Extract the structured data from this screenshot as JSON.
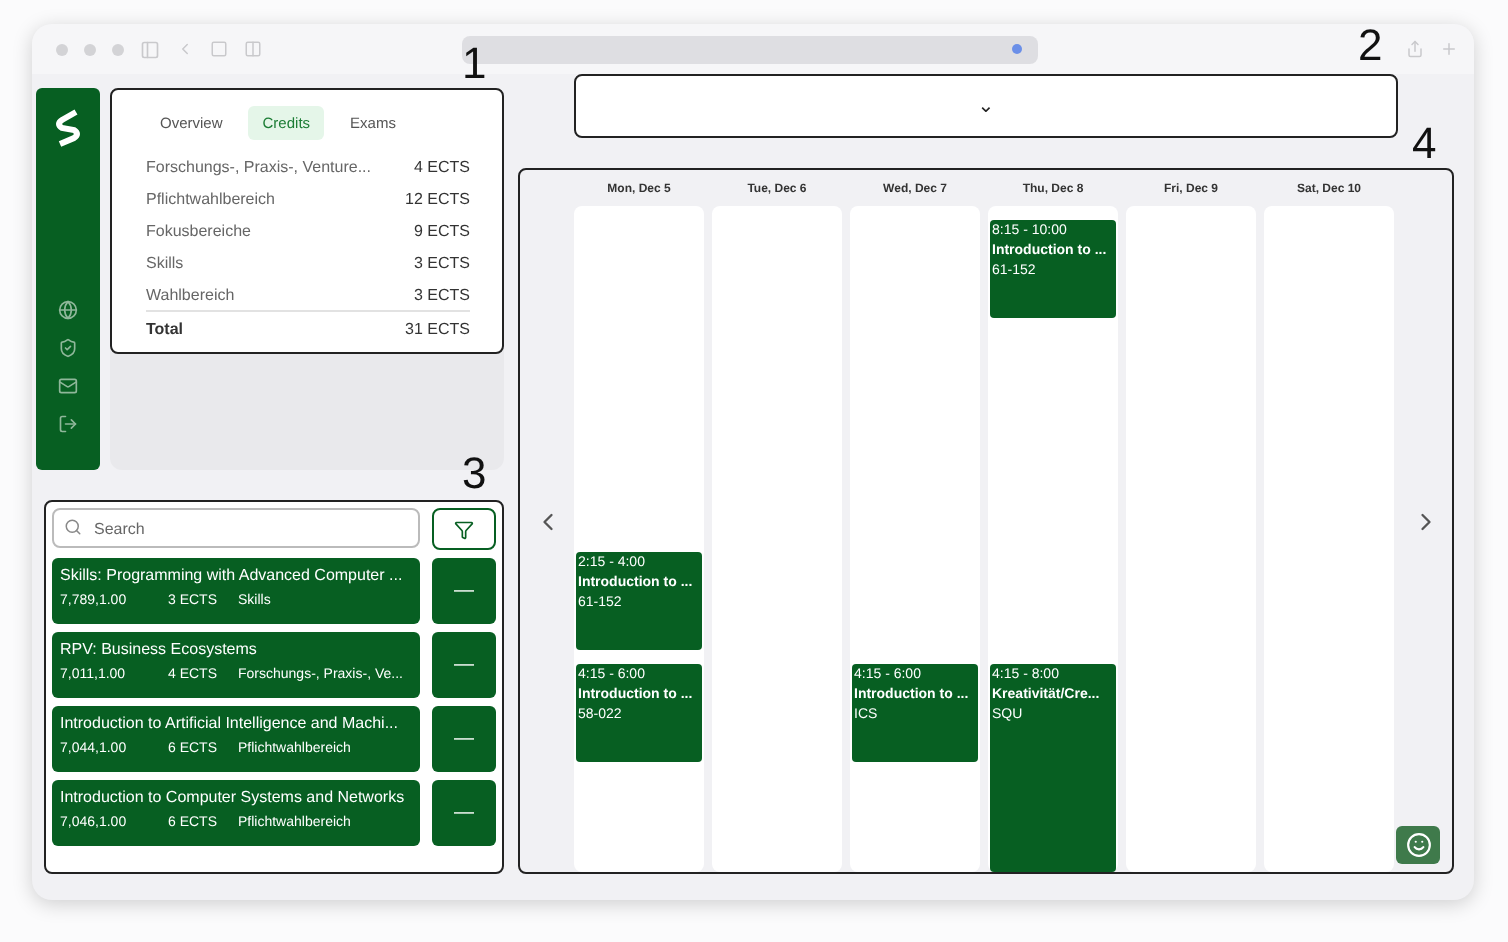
{
  "annotations": [
    "1",
    "2",
    "3",
    "4"
  ],
  "credits": {
    "tabs": [
      {
        "label": "Overview",
        "selected": false
      },
      {
        "label": "Credits",
        "selected": true
      },
      {
        "label": "Exams",
        "selected": false
      }
    ],
    "rows": [
      {
        "name": "Forschungs-, Praxis-, Venture...",
        "value": "4 ECTS"
      },
      {
        "name": "Pflichtwahlbereich",
        "value": "12 ECTS"
      },
      {
        "name": "Fokusbereiche",
        "value": "9 ECTS"
      },
      {
        "name": "Skills",
        "value": "3 ECTS"
      },
      {
        "name": "Wahlbereich",
        "value": "3 ECTS"
      }
    ],
    "total": {
      "name": "Total",
      "value": "31 ECTS"
    }
  },
  "dropdown": {
    "caret": "⌄"
  },
  "search": {
    "placeholder": "Search"
  },
  "courses": [
    {
      "title": "Skills: Programming with Advanced Computer ...",
      "code": "7,789,1.00",
      "ects": "3 ECTS",
      "area": "Skills",
      "action": "—"
    },
    {
      "title": "RPV: Business Ecosystems",
      "code": "7,011,1.00",
      "ects": "4 ECTS",
      "area": "Forschungs-, Praxis-, Ve...",
      "action": "—"
    },
    {
      "title": "Introduction to Artificial Intelligence and Machi...",
      "code": "7,044,1.00",
      "ects": "6 ECTS",
      "area": "Pflichtwahlbereich",
      "action": "—"
    },
    {
      "title": "Introduction to Computer Systems and Networks",
      "code": "7,046,1.00",
      "ects": "6 ECTS",
      "area": "Pflichtwahlbereich",
      "action": "—"
    }
  ],
  "calendar": {
    "days": [
      {
        "label": "Mon, Dec 5",
        "events": [
          {
            "time": "2:15 - 4:00",
            "title": "Introduction to ...",
            "room": "61-152"
          },
          {
            "time": "4:15 - 6:00",
            "title": "Introduction to ...",
            "room": "58-022"
          }
        ]
      },
      {
        "label": "Tue, Dec 6"
      },
      {
        "label": "Wed, Dec 7",
        "events": [
          {
            "time": "4:15 - 6:00",
            "title": "Introduction to ...",
            "room": "ICS"
          }
        ]
      },
      {
        "label": "Thu, Dec 8",
        "events": [
          {
            "time": "8:15 - 10:00",
            "title": "Introduction to ...",
            "room": "61-152"
          },
          {
            "time": "4:15 - 8:00",
            "title": "Kreativität/Cre...",
            "room": "SQU"
          }
        ]
      },
      {
        "label": "Fri, Dec 9"
      },
      {
        "label": "Sat, Dec 10"
      }
    ]
  }
}
